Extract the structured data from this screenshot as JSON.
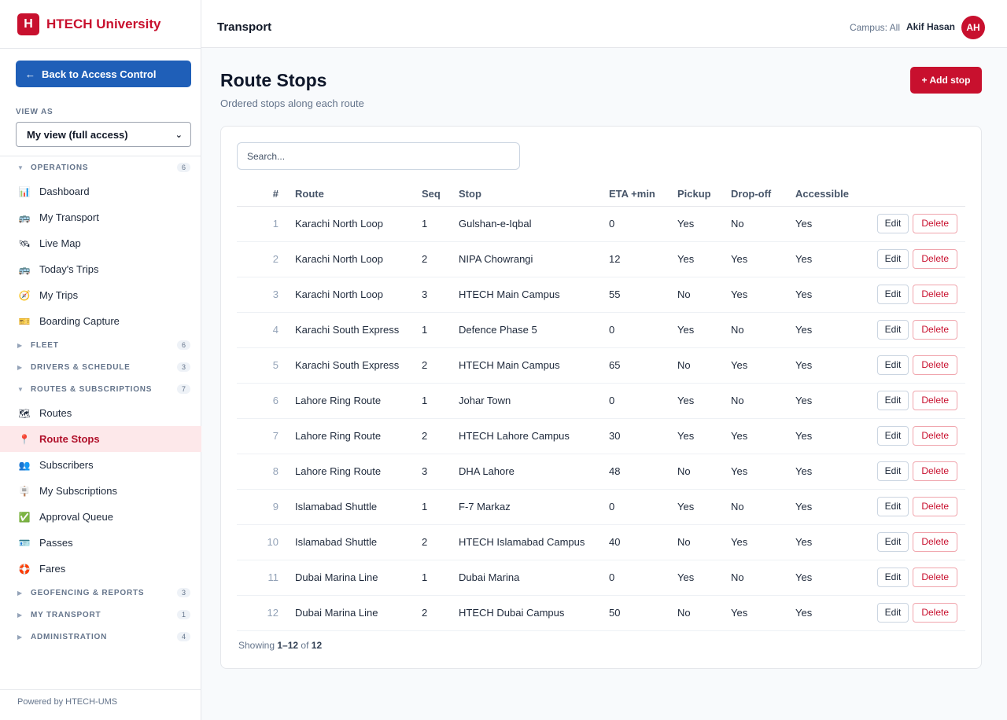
{
  "brand": {
    "logo_letter": "H",
    "name": "HTECH University",
    "color": "#c8102e"
  },
  "sidebar": {
    "back_label": "Back to Access Control",
    "back_arrow": "←",
    "view_as_label": "VIEW AS",
    "view_as_value": "My view (full access)",
    "footer": "Powered by HTECH-UMS",
    "groups": [
      {
        "title": "OPERATIONS",
        "count": "6",
        "expanded": true,
        "items": [
          {
            "label": "Dashboard",
            "icon": "chart-icon",
            "glyph": "📊"
          },
          {
            "label": "My Transport",
            "icon": "bus-icon",
            "glyph": "🚌"
          },
          {
            "label": "Live Map",
            "icon": "satellite-icon",
            "glyph": "🛰"
          },
          {
            "label": "Today's Trips",
            "icon": "bus-icon",
            "glyph": "🚌"
          },
          {
            "label": "My Trips",
            "icon": "compass-icon",
            "glyph": "🧭"
          },
          {
            "label": "Boarding Capture",
            "icon": "ticket-icon",
            "glyph": "🎫"
          }
        ]
      },
      {
        "title": "FLEET",
        "count": "6",
        "expanded": false,
        "items": []
      },
      {
        "title": "DRIVERS & SCHEDULE",
        "count": "3",
        "expanded": false,
        "items": []
      },
      {
        "title": "ROUTES & SUBSCRIPTIONS",
        "count": "7",
        "expanded": true,
        "items": [
          {
            "label": "Routes",
            "icon": "map-icon",
            "glyph": "🗺"
          },
          {
            "label": "Route Stops",
            "icon": "pin-icon",
            "glyph": "📍",
            "active": true
          },
          {
            "label": "Subscribers",
            "icon": "users-icon",
            "glyph": "👥"
          },
          {
            "label": "My Subscriptions",
            "icon": "signpost-icon",
            "glyph": "🪧"
          },
          {
            "label": "Approval Queue",
            "icon": "check-icon",
            "glyph": "✅"
          },
          {
            "label": "Passes",
            "icon": "id-card-icon",
            "glyph": "🪪"
          },
          {
            "label": "Fares",
            "icon": "lifebuoy-icon",
            "glyph": "🛟"
          }
        ]
      },
      {
        "title": "GEOFENCING & REPORTS",
        "count": "3",
        "expanded": false,
        "items": []
      },
      {
        "title": "MY TRANSPORT",
        "count": "1",
        "expanded": false,
        "items": []
      },
      {
        "title": "ADMINISTRATION",
        "count": "4",
        "expanded": false,
        "items": []
      }
    ]
  },
  "header": {
    "title": "Transport",
    "campus": "Campus: All",
    "user_name": "Akif Hasan",
    "avatar_initials": "AH"
  },
  "main": {
    "title": "Route Stops",
    "subtitle": "Ordered stops along each route",
    "add_label": "+ Add stop",
    "search_placeholder": "Search...",
    "columns": [
      "#",
      "Route",
      "Seq",
      "Stop",
      "ETA +min",
      "Pickup",
      "Drop-off",
      "Accessible"
    ],
    "edit_label": "Edit",
    "delete_label": "Delete",
    "rows": [
      {
        "num": "1",
        "route": "Karachi North Loop",
        "seq": "1",
        "stop": "Gulshan-e-Iqbal",
        "eta": "0",
        "pickup": "Yes",
        "dropoff": "No",
        "accessible": "Yes"
      },
      {
        "num": "2",
        "route": "Karachi North Loop",
        "seq": "2",
        "stop": "NIPA Chowrangi",
        "eta": "12",
        "pickup": "Yes",
        "dropoff": "Yes",
        "accessible": "Yes"
      },
      {
        "num": "3",
        "route": "Karachi North Loop",
        "seq": "3",
        "stop": "HTECH Main Campus",
        "eta": "55",
        "pickup": "No",
        "dropoff": "Yes",
        "accessible": "Yes"
      },
      {
        "num": "4",
        "route": "Karachi South Express",
        "seq": "1",
        "stop": "Defence Phase 5",
        "eta": "0",
        "pickup": "Yes",
        "dropoff": "No",
        "accessible": "Yes"
      },
      {
        "num": "5",
        "route": "Karachi South Express",
        "seq": "2",
        "stop": "HTECH Main Campus",
        "eta": "65",
        "pickup": "No",
        "dropoff": "Yes",
        "accessible": "Yes"
      },
      {
        "num": "6",
        "route": "Lahore Ring Route",
        "seq": "1",
        "stop": "Johar Town",
        "eta": "0",
        "pickup": "Yes",
        "dropoff": "No",
        "accessible": "Yes"
      },
      {
        "num": "7",
        "route": "Lahore Ring Route",
        "seq": "2",
        "stop": "HTECH Lahore Campus",
        "eta": "30",
        "pickup": "Yes",
        "dropoff": "Yes",
        "accessible": "Yes"
      },
      {
        "num": "8",
        "route": "Lahore Ring Route",
        "seq": "3",
        "stop": "DHA Lahore",
        "eta": "48",
        "pickup": "No",
        "dropoff": "Yes",
        "accessible": "Yes"
      },
      {
        "num": "9",
        "route": "Islamabad Shuttle",
        "seq": "1",
        "stop": "F-7 Markaz",
        "eta": "0",
        "pickup": "Yes",
        "dropoff": "No",
        "accessible": "Yes"
      },
      {
        "num": "10",
        "route": "Islamabad Shuttle",
        "seq": "2",
        "stop": "HTECH Islamabad Campus",
        "eta": "40",
        "pickup": "No",
        "dropoff": "Yes",
        "accessible": "Yes"
      },
      {
        "num": "11",
        "route": "Dubai Marina Line",
        "seq": "1",
        "stop": "Dubai Marina",
        "eta": "0",
        "pickup": "Yes",
        "dropoff": "No",
        "accessible": "Yes"
      },
      {
        "num": "12",
        "route": "Dubai Marina Line",
        "seq": "2",
        "stop": "HTECH Dubai Campus",
        "eta": "50",
        "pickup": "No",
        "dropoff": "Yes",
        "accessible": "Yes"
      }
    ],
    "showing": {
      "prefix": "Showing",
      "range": "1–12",
      "of": "of",
      "total": "12"
    }
  }
}
